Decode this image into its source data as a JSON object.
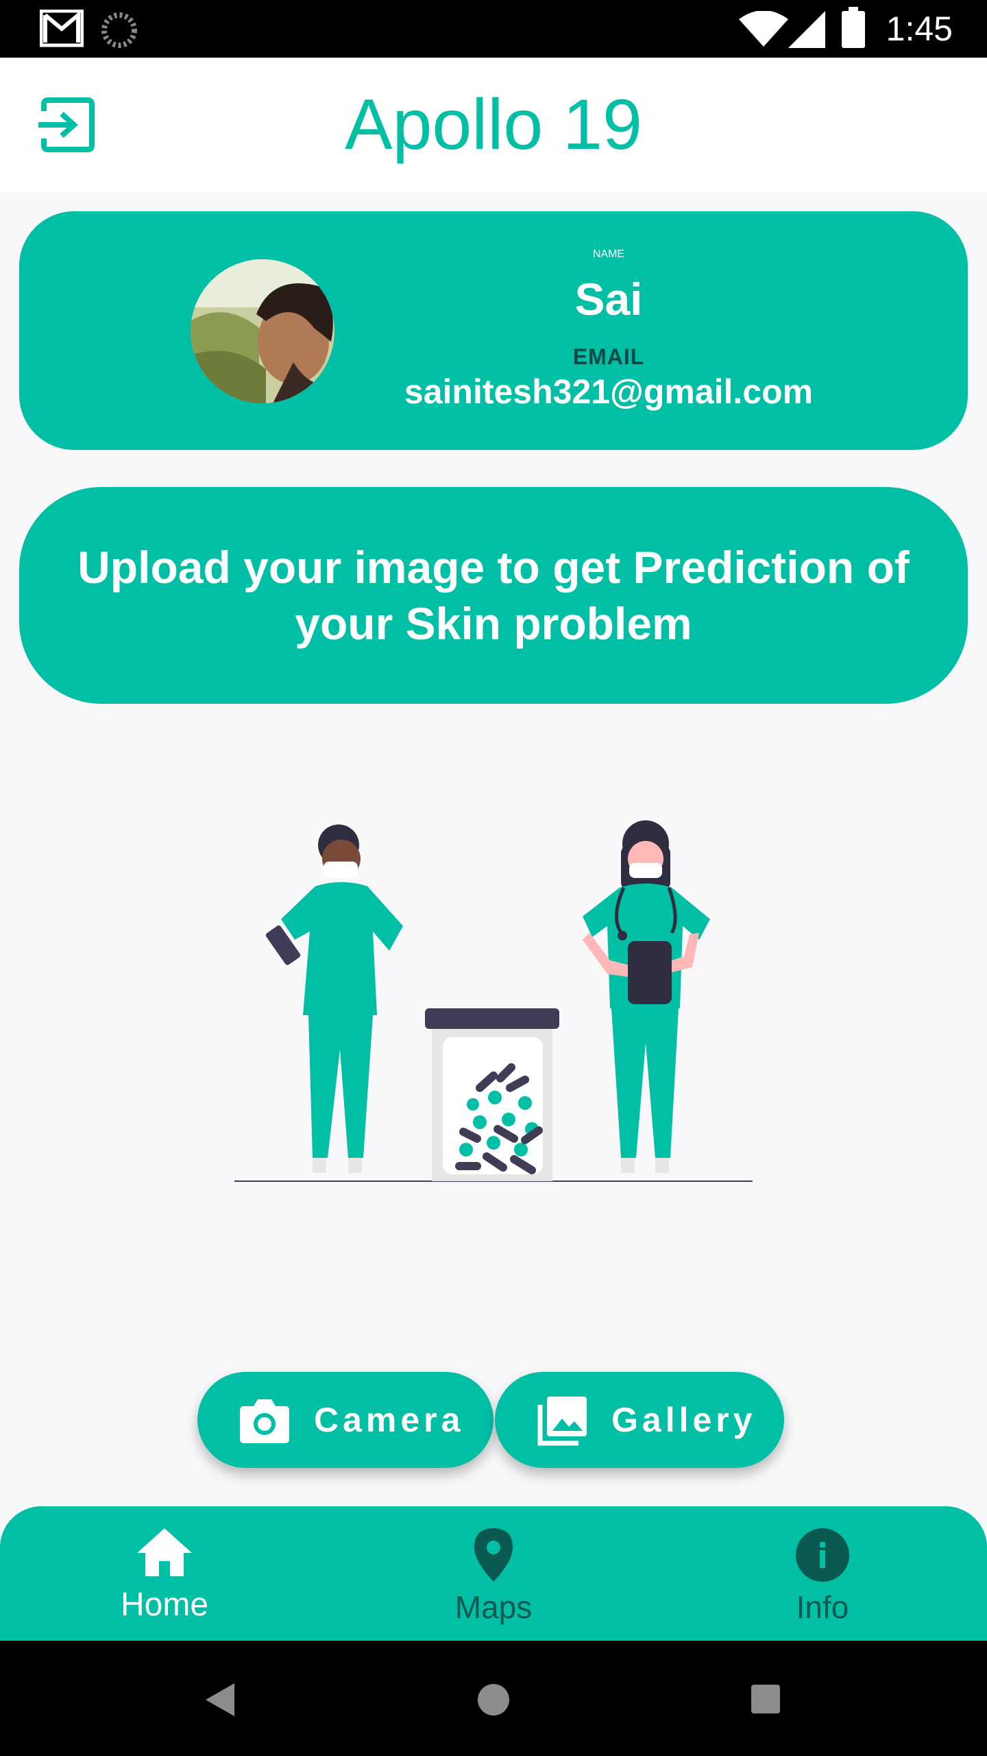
{
  "status_bar": {
    "time": "1:45"
  },
  "app_bar": {
    "title": "Apollo 19",
    "exit_icon": "exit-to-app-icon"
  },
  "profile": {
    "name_label": "NAME",
    "name": "Sai",
    "email_label": "EMAIL",
    "email": "sainitesh321@gmail.com"
  },
  "upload_prompt": "Upload your image to get Prediction of your Skin problem",
  "actions": {
    "camera_label": "Camera",
    "gallery_label": "Gallery"
  },
  "bottom_nav": {
    "items": [
      {
        "label": "Home",
        "icon": "home-icon",
        "active": true
      },
      {
        "label": "Maps",
        "icon": "map-pin-icon",
        "active": false
      },
      {
        "label": "Info",
        "icon": "info-icon",
        "active": false
      }
    ]
  },
  "colors": {
    "accent": "#01bfa5",
    "dark_teal": "#0b4a44",
    "nav_inactive": "#0b5a52"
  }
}
